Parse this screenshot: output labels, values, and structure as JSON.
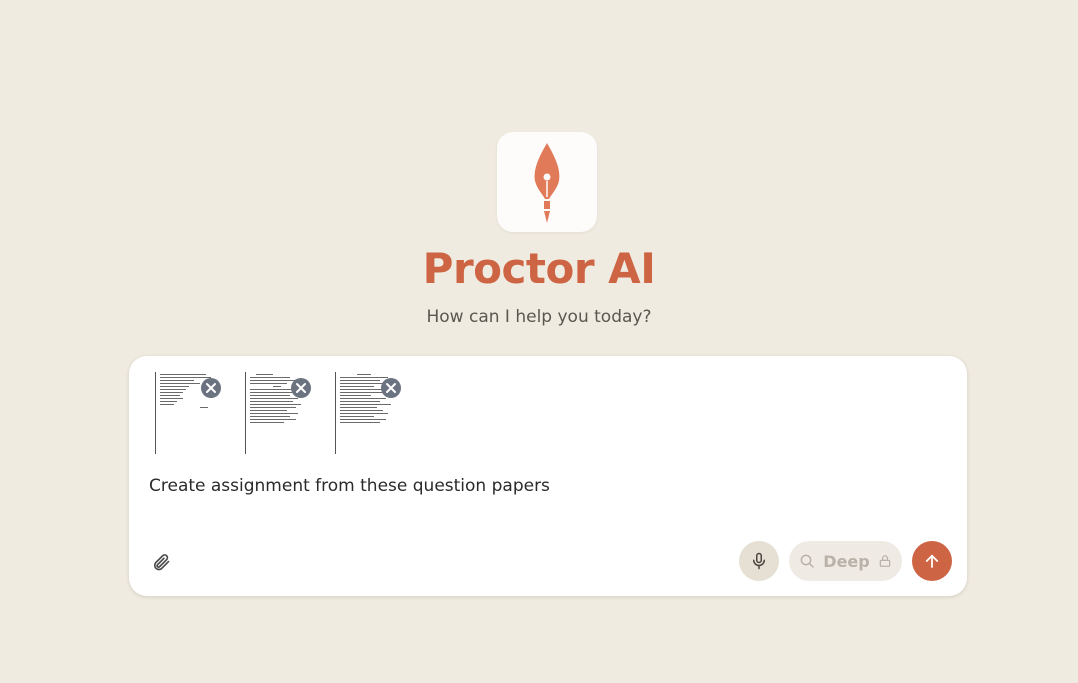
{
  "app": {
    "title": "Proctor AI",
    "subtitle": "How can I help you today?"
  },
  "composer": {
    "attachments": [
      {
        "name": "question-paper-1",
        "icon": "close-circle-icon"
      },
      {
        "name": "question-paper-2",
        "icon": "close-circle-icon"
      },
      {
        "name": "question-paper-3",
        "icon": "close-circle-icon"
      }
    ],
    "prompt_text": "Create assignment from these question papers",
    "deep_label": "Deep",
    "icons": {
      "attach": "paperclip-icon",
      "mic": "microphone-icon",
      "deep_search": "search-icon",
      "deep_lock": "lock-icon",
      "send": "arrow-up-icon"
    }
  },
  "colors": {
    "background": "#f0ebe0",
    "accent": "#cd6443",
    "remove_badge": "#6b7280"
  }
}
